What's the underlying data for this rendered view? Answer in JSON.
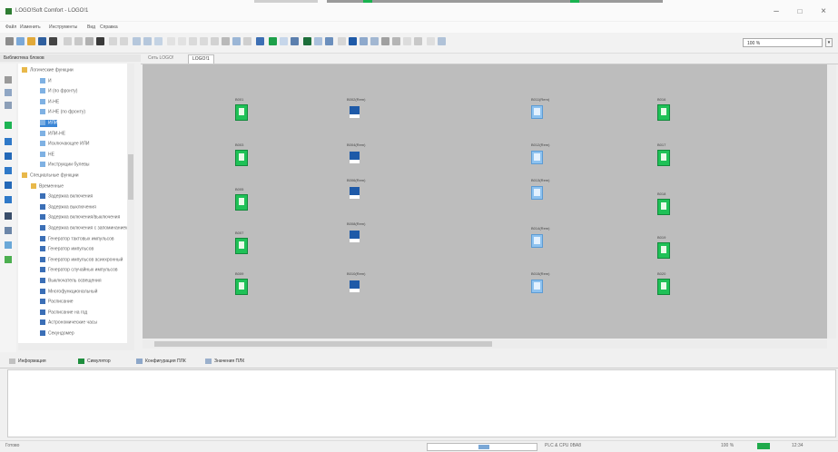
{
  "window": {
    "title": "LOGO!Soft Comfort - LOGO!1",
    "controls": [
      "–",
      "□",
      "×"
    ]
  },
  "menu": [
    "Файл",
    "Изменить",
    "Инструменты",
    "Вид",
    "Справка"
  ],
  "toolbar": {
    "zoom_combo": "100 %"
  },
  "library": {
    "header": "Библиотека блоков",
    "tree": [
      {
        "label": "Логические функции",
        "level": 0,
        "icon": "folder"
      },
      {
        "label": "И",
        "level": 2,
        "icon": "block"
      },
      {
        "label": "И (по фронту)",
        "level": 2,
        "icon": "block"
      },
      {
        "label": "И-НЕ",
        "level": 2,
        "icon": "block"
      },
      {
        "label": "И-НЕ (по фронту)",
        "level": 2,
        "icon": "block"
      },
      {
        "label": "ИЛИ",
        "level": 2,
        "icon": "block",
        "selected": true
      },
      {
        "label": "ИЛИ-НЕ",
        "level": 2,
        "icon": "block"
      },
      {
        "label": "Исключающее ИЛИ",
        "level": 2,
        "icon": "block"
      },
      {
        "label": "НЕ",
        "level": 2,
        "icon": "block"
      },
      {
        "label": "Инструкции булевы",
        "level": 2,
        "icon": "block"
      },
      {
        "label": "Специальные функции",
        "level": 0,
        "icon": "folder"
      },
      {
        "label": "Временные",
        "level": 1,
        "icon": "folder"
      },
      {
        "label": "Задержка включения",
        "level": 2,
        "icon": "timer"
      },
      {
        "label": "Задержка выключения",
        "level": 2,
        "icon": "timer"
      },
      {
        "label": "Задержка включения/выключения",
        "level": 2,
        "icon": "timer"
      },
      {
        "label": "Задержка включения с запоминанием",
        "level": 2,
        "icon": "timer"
      },
      {
        "label": "Генератор тактовых импульсов",
        "level": 2,
        "icon": "timer"
      },
      {
        "label": "Генератор импульсов",
        "level": 2,
        "icon": "timer"
      },
      {
        "label": "Генератор импульсов асинхронный",
        "level": 2,
        "icon": "timer"
      },
      {
        "label": "Генератор случайных импульсов",
        "level": 2,
        "icon": "timer"
      },
      {
        "label": "Выключатель освещения",
        "level": 2,
        "icon": "timer"
      },
      {
        "label": "Многофункциональный",
        "level": 2,
        "icon": "timer"
      },
      {
        "label": "Расписание",
        "level": 2,
        "icon": "timer"
      },
      {
        "label": "Расписание на год",
        "level": 2,
        "icon": "timer"
      },
      {
        "label": "Астрономические часы",
        "level": 2,
        "icon": "timer"
      },
      {
        "label": "Секундомер",
        "level": 2,
        "icon": "timer"
      }
    ]
  },
  "editor_tabs": [
    {
      "label": "Сеть LOGO!",
      "active": false
    },
    {
      "label": "LOGO!1",
      "active": true
    }
  ],
  "diagram": {
    "blocks": [
      {
        "kind": "green",
        "label": "B001"
      },
      {
        "kind": "green",
        "label": "B003"
      },
      {
        "kind": "green",
        "label": "B005"
      },
      {
        "kind": "green",
        "label": "B007"
      },
      {
        "kind": "green",
        "label": "B009"
      },
      {
        "kind": "dark",
        "label": "B002(Rem)"
      },
      {
        "kind": "dark",
        "label": "B004(Rem)"
      },
      {
        "kind": "dark",
        "label": "B006(Rem)"
      },
      {
        "kind": "dark",
        "label": "B008(Rem)"
      },
      {
        "kind": "dark",
        "label": "B010(Rem)"
      },
      {
        "kind": "light",
        "label": "B011(Rem)"
      },
      {
        "kind": "light",
        "label": "B012(Rem)"
      },
      {
        "kind": "light",
        "label": "B013(Rem)"
      },
      {
        "kind": "light",
        "label": "B014(Rem)"
      },
      {
        "kind": "light",
        "label": "B015(Rem)"
      },
      {
        "kind": "green",
        "label": "B016"
      },
      {
        "kind": "green",
        "label": "B017"
      },
      {
        "kind": "green",
        "label": "B018"
      },
      {
        "kind": "green",
        "label": "B019"
      },
      {
        "kind": "green",
        "label": "B020"
      }
    ]
  },
  "bottom_tabs": [
    {
      "label": "Информация"
    },
    {
      "label": "Симулятор"
    },
    {
      "label": "Конфигурация ПЛК"
    },
    {
      "label": "Значения ПЛК"
    }
  ],
  "status": {
    "left": "Готово",
    "mid": "PLC & CPU 0BA8",
    "zoom": "100 %",
    "time": "12:34"
  }
}
